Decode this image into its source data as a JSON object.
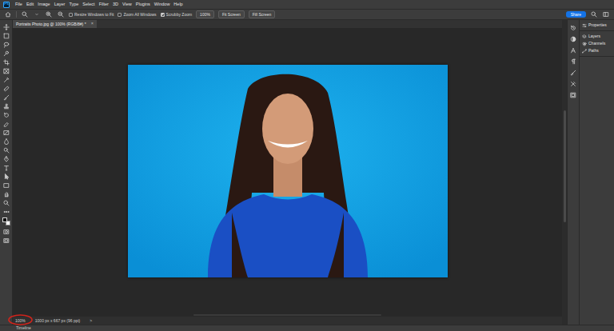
{
  "app": {
    "logo": "Ps"
  },
  "menu": [
    "File",
    "Edit",
    "Image",
    "Layer",
    "Type",
    "Select",
    "Filter",
    "3D",
    "View",
    "Plugins",
    "Window",
    "Help"
  ],
  "options": {
    "checkboxes": [
      {
        "label": "Resize Windows to Fit",
        "checked": false
      },
      {
        "label": "Zoom All Windows",
        "checked": false
      },
      {
        "label": "Scrubby Zoom",
        "checked": true
      }
    ],
    "buttons": [
      "100%",
      "Fit Screen",
      "Fill Screen"
    ],
    "share": "Share"
  },
  "document_tab": {
    "title": "Portraits Photo.jpg @ 100% (RGB/8#) *",
    "close": "×"
  },
  "panel_groups": [
    [
      "Properties"
    ],
    [
      "Layers",
      "Channels",
      "Paths"
    ]
  ],
  "status_bar": {
    "zoom": "100%",
    "size": "1000 px x 667 px (96 ppi)",
    "arrow": ">"
  },
  "timeline": "Timeline"
}
